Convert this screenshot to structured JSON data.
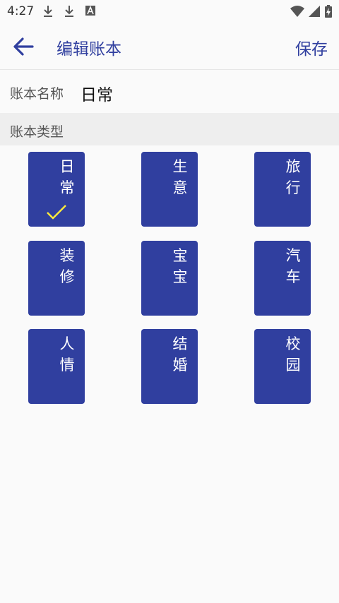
{
  "status_bar": {
    "time": "4:27",
    "icons": [
      "download-icon",
      "download-icon",
      "font-a-icon",
      "wifi-icon",
      "signal-icon",
      "battery-charging-icon"
    ]
  },
  "app_bar": {
    "title": "编辑账本",
    "save_label": "保存"
  },
  "account_name": {
    "label": "账本名称",
    "value": "日常"
  },
  "account_type": {
    "label": "账本类型"
  },
  "types": [
    {
      "label": "日常",
      "selected": true
    },
    {
      "label": "生意",
      "selected": false
    },
    {
      "label": "旅行",
      "selected": false
    },
    {
      "label": "装修",
      "selected": false
    },
    {
      "label": "宝宝",
      "selected": false
    },
    {
      "label": "汽车",
      "selected": false
    },
    {
      "label": "人情",
      "selected": false
    },
    {
      "label": "结婚",
      "selected": false
    },
    {
      "label": "校园",
      "selected": false
    }
  ],
  "colors": {
    "accent": "#303f9f",
    "check": "#ffeb3b",
    "header_bg": "#eeeeee"
  }
}
